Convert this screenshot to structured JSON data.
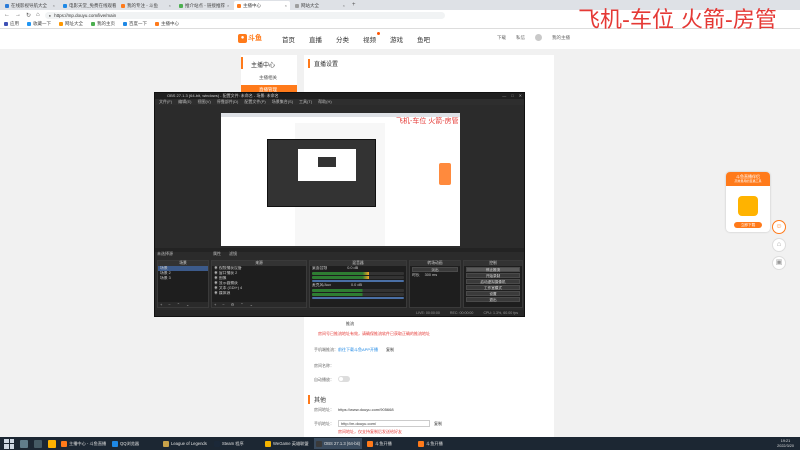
{
  "browser": {
    "tabs": [
      {
        "label": "在线影视导航大全",
        "color": "#2b7bd8",
        "active": false
      },
      {
        "label": "电影天堂_免费在线观看",
        "color": "#1e88e5",
        "active": false
      },
      {
        "label": "我的专注 - 斗鱼",
        "color": "#ff7a1a",
        "active": false
      },
      {
        "label": "推介站点 - 链接推荐",
        "color": "#4caf50",
        "active": false
      },
      {
        "label": "主播中心",
        "color": "#ff7a1a",
        "active": true
      },
      {
        "label": "网站大全",
        "color": "#9e9e9e",
        "active": false
      }
    ],
    "new_tab": "+",
    "url": "https://mp.douyu.com/live/main",
    "nav": {
      "back": "←",
      "forward": "→",
      "reload": "↻",
      "home": "⌂"
    },
    "bookmarks": [
      "应用",
      "收藏一下",
      "网址大全",
      "我的主页",
      "百度一下",
      "主播中心"
    ]
  },
  "overlay_text": "飞机-车位 火箭-房管",
  "site": {
    "logo_text": "斗鱼",
    "nav": [
      "首页",
      "直播",
      "分类",
      "视频",
      "游戏",
      "鱼吧"
    ],
    "hot_index": 3,
    "header_right": [
      "下载",
      "私信",
      "我的主播"
    ],
    "sidebar_title": "主播中心",
    "sidebar_items": [
      "主播相关",
      "直播管理"
    ],
    "section_live_settings": "直播设置",
    "labels": {
      "stream_setting": "推流",
      "room_link_label": "直播间链接：",
      "room_link": "https://www.douyu.com/905668",
      "mobile_label": "手机端推流：",
      "mobile_link": "前往下载斗鱼APP开播",
      "mobile_action": "复制",
      "red_note": "房间号已推流地址有效，请确保推流软件已获取正确的推流地址",
      "nickname_label": "房间名称：",
      "auto_label": "自动播放：",
      "other_section": "其他",
      "room_address_label": "房间地址：",
      "room_address": "https://www.douyu.com/905668",
      "mobile_addr_label": "手机地址：",
      "mobile_addr_value": "http://m.douyu.com/",
      "copy": "复制",
      "small_red": "房间地址，仅支持复制后发送给好友"
    }
  },
  "obs": {
    "title": "OBS 27.1.3 (64-bit, windows) - 配置文件: 未命名 - 场景: 未命名",
    "menu": [
      "文件(F)",
      "编辑(E)",
      "视图(V)",
      "停靠部件(D)",
      "配置文件(P)",
      "场景集合(S)",
      "工具(T)",
      "帮助(H)"
    ],
    "preview_overlay": "飞机-车位 火箭-房管",
    "label_row": [
      "未选择源",
      "属性",
      "滤镜"
    ],
    "scenes_header": "场景",
    "scenes": [
      "场景",
      "场景 2",
      "场景 3"
    ],
    "sources_header": "来源",
    "sources": [
      "视频捕获设备",
      "窗口捕获 2",
      "图像",
      "显示器捕获",
      "文本 (GDI+) 4",
      "媒体源"
    ],
    "mixer_header": "混音器",
    "mixer": [
      {
        "name": "桌面音频",
        "db": "0.0 dB",
        "level": 0.62
      },
      {
        "name": "麦克风/Aux",
        "db": "0.0 dB",
        "level": 0.55
      }
    ],
    "transition_header": "转场动画",
    "transition": "淡出",
    "duration_label": "时长",
    "duration": "300 ms",
    "controls_header": "控制",
    "controls": [
      "停止推流",
      "开始录制",
      "启动虚拟摄像机",
      "工作室模式",
      "设置",
      "退出"
    ],
    "status": [
      "LIVE: 00:00:00",
      "REC: 00:00:00",
      "CPU: 1.3%, 60.00 fps"
    ]
  },
  "float_ad": {
    "head": "斗鱼直播伴侣",
    "sub": "高效易用的直播工具",
    "button": "立即下载"
  },
  "side_tools": [
    {
      "name": "chat-icon",
      "glyph": "☺"
    },
    {
      "name": "home-icon",
      "glyph": "⌂"
    },
    {
      "name": "app-icon",
      "glyph": "▣"
    }
  ],
  "taskbar": {
    "apps": [
      {
        "label": "主播中心 - 斗鱼直播",
        "color": "#ff7a1a",
        "active": false
      },
      {
        "label": "QQ浏览器",
        "color": "#1e88e5",
        "active": false
      },
      {
        "label": "League of Legends",
        "color": "#c8a24a",
        "active": false
      },
      {
        "label": "Steam 程序",
        "color": "#1b2838",
        "active": false
      },
      {
        "label": "WeGame 英雄联盟",
        "color": "#f5b400",
        "active": false
      },
      {
        "label": "OBS 27.1.3 (64-bit)",
        "color": "#3a3a3a",
        "active": true
      },
      {
        "label": "斗鱼开播",
        "color": "#ff7a1a",
        "active": false
      },
      {
        "label": "斗鱼开播",
        "color": "#ff7a1a",
        "active": false
      }
    ],
    "time": "19:21",
    "date": "2022/3/20"
  }
}
